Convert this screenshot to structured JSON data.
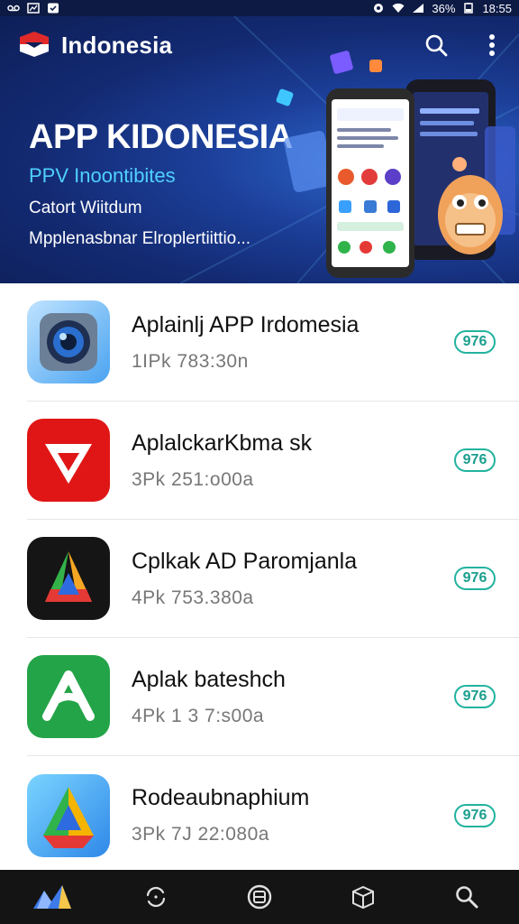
{
  "status_bar": {
    "battery_percent": "36%",
    "time": "18:55"
  },
  "header": {
    "title": "Indonesia",
    "icons": [
      "indonesia-flag-logo",
      "search-icon",
      "more-vert-icon"
    ]
  },
  "hero": {
    "heading": "APP KIDONESIA",
    "subheading": "PPV Inoontibites",
    "line1": "Catort Wiitdum",
    "line2": "Mpplenasbnar Elroplertiittio..."
  },
  "apps": [
    {
      "name": "Aplainlj APP Irdomesia",
      "meta": "1IPk 783:30n",
      "rating": "976",
      "icon": "camera-lens-icon"
    },
    {
      "name": "AplalckarKbma sk",
      "meta": "3Pk 251:o00a",
      "rating": "976",
      "icon": "red-triangle-icon"
    },
    {
      "name": "Cplkak AD Paromjanla",
      "meta": "4Pk 753.380a",
      "rating": "976",
      "icon": "multicolor-a-icon"
    },
    {
      "name": "Aplak bateshch",
      "meta": "4Pk 1 3 7:s00a",
      "rating": "976",
      "icon": "green-a-icon"
    },
    {
      "name": "Rodeaubnaphium",
      "meta": "3Pk 7J 22:080a",
      "rating": "976",
      "icon": "drive-triangle-icon"
    }
  ],
  "bottom_nav": {
    "items": [
      "home-icon",
      "refresh-icon",
      "apps-icon",
      "box-icon",
      "search-icon"
    ]
  },
  "colors": {
    "hero_dark": "#0e1f58",
    "hero_accent": "#4fd0ff",
    "rating_teal": "#22b39f",
    "nav_bg": "#141414"
  }
}
